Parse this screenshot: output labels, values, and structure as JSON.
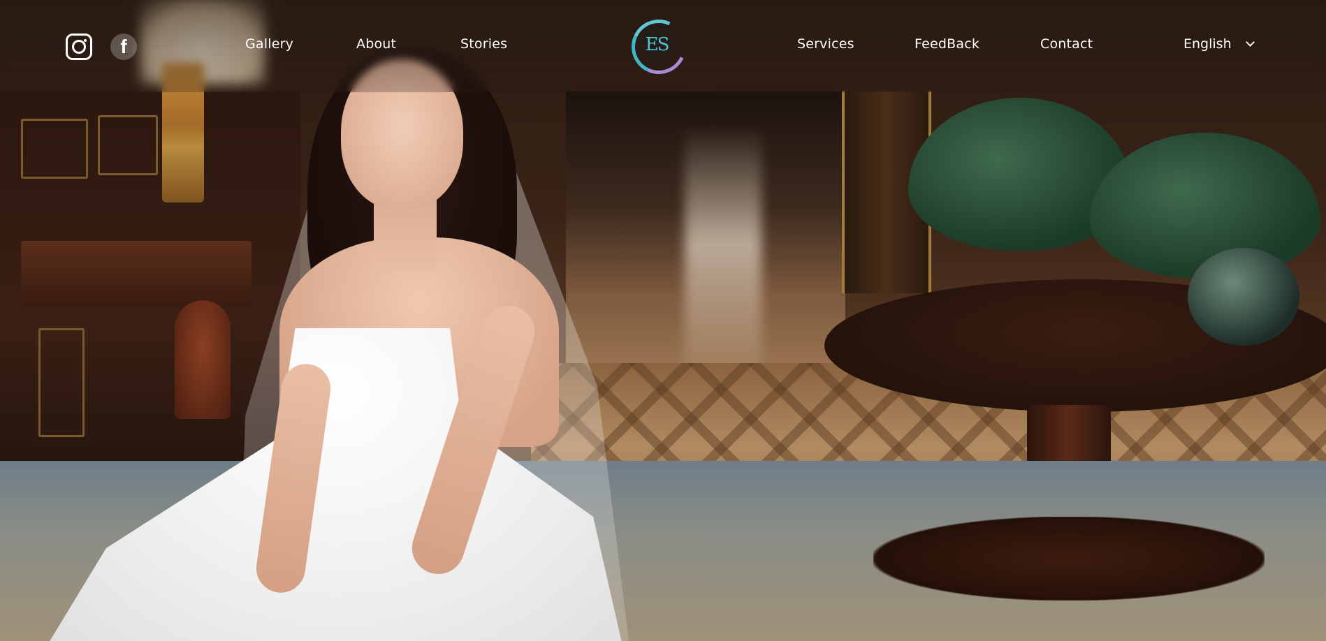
{
  "header": {
    "social": [
      {
        "icon": "instagram-icon"
      },
      {
        "icon": "facebook-icon",
        "glyph": "f"
      }
    ],
    "nav_left": [
      "Gallery",
      "About",
      "Stories"
    ],
    "logo": {
      "text": "ES"
    },
    "nav_right": [
      "Services",
      "FeedBack",
      "Contact"
    ],
    "language": {
      "selected": "English"
    }
  },
  "colors": {
    "logo_accent": "#52c6d0",
    "logo_secondary": "#a98bd6",
    "nav_text": "#ffffff"
  }
}
